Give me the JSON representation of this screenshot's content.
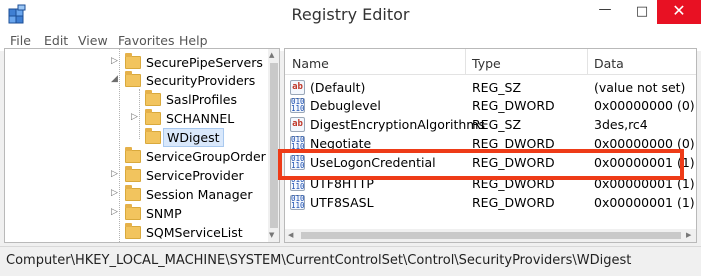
{
  "window": {
    "title": "Registry Editor",
    "controls": {
      "minimize": "—",
      "maximize": "□",
      "close": "✕"
    }
  },
  "menu": [
    "File",
    "Edit",
    "View",
    "Favorites",
    "Help"
  ],
  "tree": {
    "items": [
      {
        "label": "SecurePipeServers",
        "arrow": "▷"
      },
      {
        "label": "SecurityProviders",
        "arrow": "◢"
      },
      {
        "label": "SaslProfiles",
        "arrow": ""
      },
      {
        "label": "SCHANNEL",
        "arrow": "▷"
      },
      {
        "label": "WDigest",
        "arrow": "",
        "selected": true
      },
      {
        "label": "ServiceGroupOrder",
        "arrow": ""
      },
      {
        "label": "ServiceProvider",
        "arrow": "▷"
      },
      {
        "label": "Session Manager",
        "arrow": "▷"
      },
      {
        "label": "SNMP",
        "arrow": "▷"
      },
      {
        "label": "SQMServiceList",
        "arrow": ""
      }
    ]
  },
  "list": {
    "columns": [
      "Name",
      "Type",
      "Data"
    ],
    "rows": [
      {
        "name": "(Default)",
        "type": "REG_SZ",
        "data": "(value not set)",
        "icon": "ab"
      },
      {
        "name": "Debuglevel",
        "type": "REG_DWORD",
        "data": "0x00000000 (0)",
        "icon": "010 110"
      },
      {
        "name": "DigestEncryptionAlgorithms",
        "type": "REG_SZ",
        "data": "3des,rc4",
        "icon": "ab"
      },
      {
        "name": "Negotiate",
        "type": "REG_DWORD",
        "data": "0x00000000 (0)",
        "icon": "010 110"
      },
      {
        "name": "UseLogonCredential",
        "type": "REG_DWORD",
        "data": "0x00000001 (1)",
        "icon": "010 110"
      },
      {
        "name": "UTF8HTTP",
        "type": "REG_DWORD",
        "data": "0x00000001 (1)",
        "icon": "010 110"
      },
      {
        "name": "UTF8SASL",
        "type": "REG_DWORD",
        "data": "0x00000001 (1)",
        "icon": "010 110"
      }
    ]
  },
  "status": {
    "path": "Computer\\HKEY_LOCAL_MACHINE\\SYSTEM\\CurrentControlSet\\Control\\SecurityProviders\\WDigest"
  },
  "colors": {
    "highlight": "#ee3b17",
    "close_button": "#e81123",
    "folder": "#f2c45e"
  }
}
